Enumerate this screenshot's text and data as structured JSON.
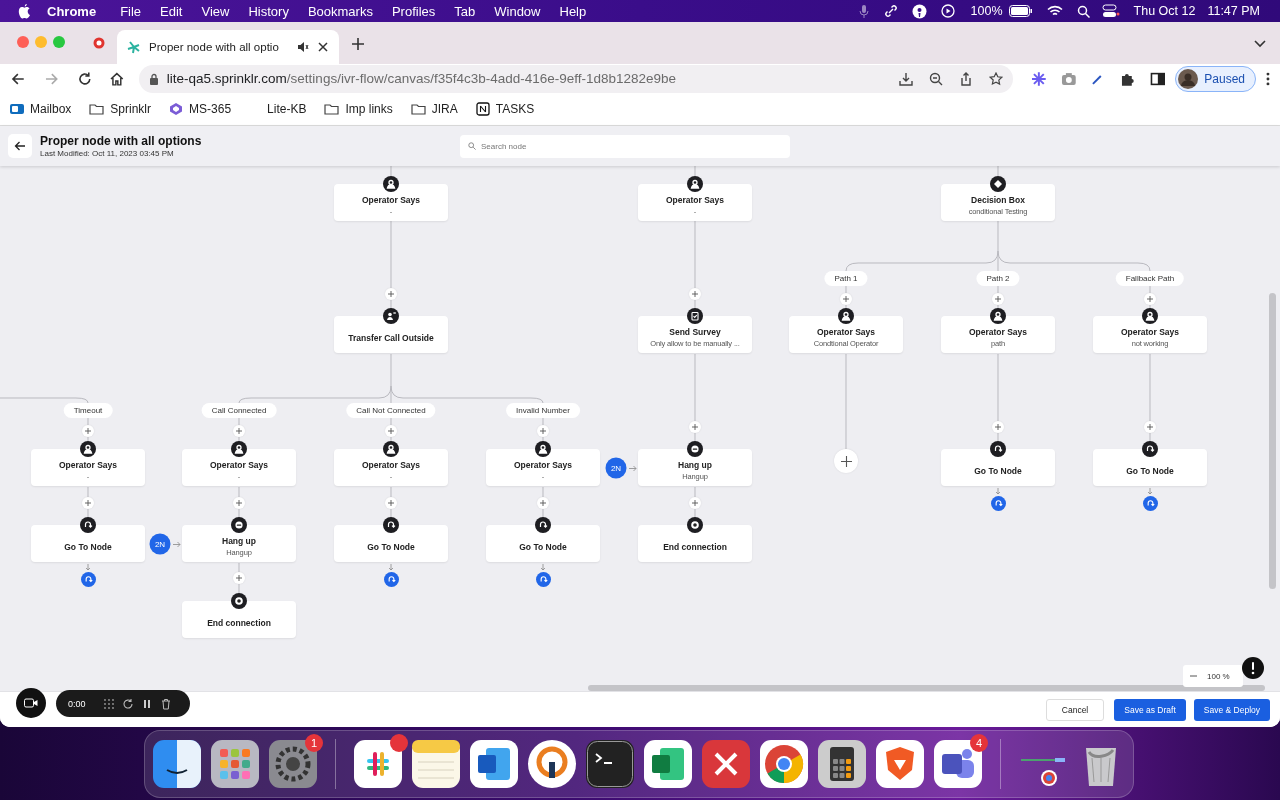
{
  "menu_bar": {
    "app": "Chrome",
    "menus": [
      "File",
      "Edit",
      "View",
      "History",
      "Bookmarks",
      "Profiles",
      "Tab",
      "Window",
      "Help"
    ],
    "battery": "100%",
    "date": "Thu Oct 12",
    "time": "11:47 PM"
  },
  "browser": {
    "tab_title": "Proper node with all optio",
    "url_host": "lite-qa5.sprinklr.com",
    "url_path": "/settings/ivr-flow/canvas/f35f4c3b-4add-416e-9eff-1d8b1282e9be",
    "profile": "Paused",
    "bookmarks": [
      {
        "label": "Mailbox",
        "kind": "mail"
      },
      {
        "label": "Sprinklr",
        "kind": "folder"
      },
      {
        "label": "MS-365",
        "kind": "ms"
      },
      {
        "label": "Lite-KB",
        "kind": "blank"
      },
      {
        "label": "Imp links",
        "kind": "folder"
      },
      {
        "label": "JIRA",
        "kind": "folder"
      },
      {
        "label": "TASKS",
        "kind": "notion"
      }
    ]
  },
  "header": {
    "title": "Proper node with all options",
    "last_modified": "Last Modified: Oct 11, 2023 03:45 PM",
    "search": {
      "placeholder": "Search node"
    }
  },
  "canvas": {
    "nodes": [
      {
        "kind": "operator",
        "title": "Operator Says",
        "subtitle": "-"
      },
      {
        "kind": "operator",
        "title": "Operator Says",
        "subtitle": "-"
      },
      {
        "kind": "decision",
        "title": "Decision Box",
        "subtitle": "conditional Testing"
      },
      {
        "kind": "transfer",
        "title": "Transfer Call Outside"
      },
      {
        "kind": "survey",
        "title": "Send Survey",
        "subtitle": "Only allow to be manually ..."
      },
      {
        "kind": "operator",
        "title": "Operator Says",
        "subtitle": "Condtional Operator"
      },
      {
        "kind": "operator",
        "title": "Operator Says",
        "subtitle": "path"
      },
      {
        "kind": "operator",
        "title": "Operator Says",
        "subtitle": "not working"
      },
      {
        "kind": "operator",
        "title": "Operator Says",
        "subtitle": "-"
      },
      {
        "kind": "operator",
        "title": "Operator Says",
        "subtitle": "-"
      },
      {
        "kind": "operator",
        "title": "Operator Says",
        "subtitle": "-"
      },
      {
        "kind": "operator",
        "title": "Operator Says",
        "subtitle": "-"
      },
      {
        "kind": "hangup",
        "title": "Hang up",
        "subtitle": "Hangup"
      },
      {
        "kind": "goto",
        "title": "Go To Node"
      },
      {
        "kind": "goto",
        "title": "Go To Node"
      },
      {
        "kind": "goto",
        "title": "Go To Node"
      },
      {
        "kind": "hangup",
        "title": "Hang up",
        "subtitle": "Hangup"
      },
      {
        "kind": "goto",
        "title": "Go To Node"
      },
      {
        "kind": "goto",
        "title": "Go To Node"
      },
      {
        "kind": "end",
        "title": "End connection"
      },
      {
        "kind": "end",
        "title": "End connection"
      }
    ],
    "branch_labels": [
      "Timeout",
      "Call Connected",
      "Call Not Connected",
      "Invalid Number",
      "Path 1",
      "Path 2",
      "Fallback Path"
    ],
    "badges": [
      "2N",
      "2N"
    ],
    "zoom": "100 %"
  },
  "recorder": {
    "time": "0:00"
  },
  "footer": {
    "buttons": [
      {
        "label": "Cancel",
        "kind": "secondary"
      },
      {
        "label": "Save as Draft",
        "kind": "primary"
      },
      {
        "label": "Save & Deploy",
        "kind": "primary"
      }
    ]
  },
  "dock": [
    {
      "kind": "finder"
    },
    {
      "kind": "launchpad"
    },
    {
      "kind": "settings",
      "badge": "1"
    },
    {
      "kind": "separator"
    },
    {
      "kind": "slack",
      "notified": true
    },
    {
      "kind": "notes"
    },
    {
      "kind": "word"
    },
    {
      "kind": "vpn"
    },
    {
      "kind": "terminal"
    },
    {
      "kind": "excel"
    },
    {
      "kind": "remote"
    },
    {
      "kind": "chrome"
    },
    {
      "kind": "calculator"
    },
    {
      "kind": "brave"
    },
    {
      "kind": "teams",
      "badge": "4"
    },
    {
      "kind": "separator"
    },
    {
      "kind": "window"
    },
    {
      "kind": "trash"
    }
  ]
}
